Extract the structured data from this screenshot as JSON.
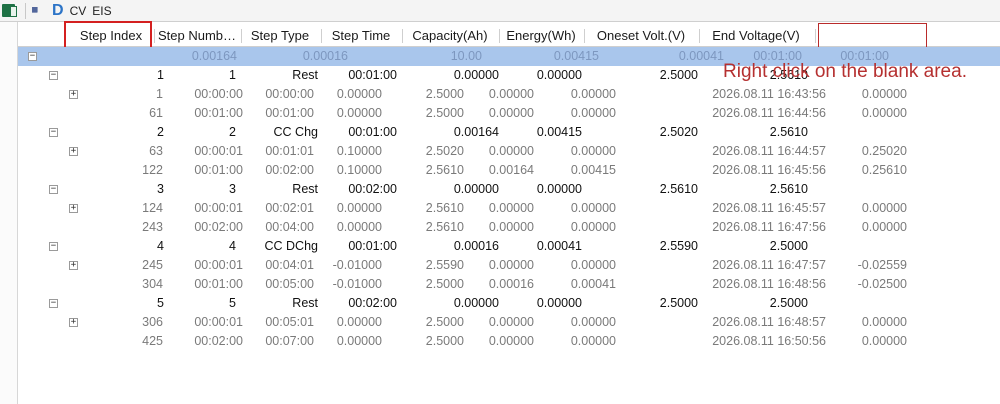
{
  "toolbar": {
    "items": [
      {
        "icon": "excel-icon"
      },
      {
        "icon": "grid-icon"
      },
      {
        "icon": "d-icon",
        "text": "D"
      },
      {
        "label": "CV"
      },
      {
        "label": "EIS"
      }
    ]
  },
  "columns": [
    "Step Index",
    "Step Numb…",
    "Step Type",
    "Step Time",
    "Capacity(Ah)",
    "Energy(Wh)",
    "Oneset Volt.(V)",
    "End Voltage(V)"
  ],
  "selected_row": {
    "cells": [
      "0.00164",
      "0.00016",
      "10.00",
      "0.00415",
      "0.00041",
      "00:01:00",
      "00:01:00"
    ]
  },
  "groups": [
    {
      "step": [
        "1",
        "1",
        "Rest",
        "00:01:00",
        "0.00000",
        "0.00000",
        "2.5000",
        "2.5610"
      ],
      "records": [
        [
          "1",
          "00:00:00",
          "00:00:00",
          "0.00000",
          "2.5000",
          "0.00000",
          "0.00000",
          "2026.08.11 16:43:56",
          "0.00000"
        ],
        [
          "61",
          "00:01:00",
          "00:01:00",
          "0.00000",
          "2.5000",
          "0.00000",
          "0.00000",
          "2026.08.11 16:44:56",
          "0.00000"
        ]
      ]
    },
    {
      "step": [
        "2",
        "2",
        "CC Chg",
        "00:01:00",
        "0.00164",
        "0.00415",
        "2.5020",
        "2.5610"
      ],
      "records": [
        [
          "63",
          "00:00:01",
          "00:01:01",
          "0.10000",
          "2.5020",
          "0.00000",
          "0.00000",
          "2026.08.11 16:44:57",
          "0.25020"
        ],
        [
          "122",
          "00:01:00",
          "00:02:00",
          "0.10000",
          "2.5610",
          "0.00164",
          "0.00415",
          "2026.08.11 16:45:56",
          "0.25610"
        ]
      ]
    },
    {
      "step": [
        "3",
        "3",
        "Rest",
        "00:02:00",
        "0.00000",
        "0.00000",
        "2.5610",
        "2.5610"
      ],
      "records": [
        [
          "124",
          "00:00:01",
          "00:02:01",
          "0.00000",
          "2.5610",
          "0.00000",
          "0.00000",
          "2026.08.11 16:45:57",
          "0.00000"
        ],
        [
          "243",
          "00:02:00",
          "00:04:00",
          "0.00000",
          "2.5610",
          "0.00000",
          "0.00000",
          "2026.08.11 16:47:56",
          "0.00000"
        ]
      ]
    },
    {
      "step": [
        "4",
        "4",
        "CC DChg",
        "00:01:00",
        "0.00016",
        "0.00041",
        "2.5590",
        "2.5000"
      ],
      "records": [
        [
          "245",
          "00:00:01",
          "00:04:01",
          "-0.01000",
          "2.5590",
          "0.00000",
          "0.00000",
          "2026.08.11 16:47:57",
          "-0.02559"
        ],
        [
          "304",
          "00:01:00",
          "00:05:00",
          "-0.01000",
          "2.5000",
          "0.00016",
          "0.00041",
          "2026.08.11 16:48:56",
          "-0.02500"
        ]
      ]
    },
    {
      "step": [
        "5",
        "5",
        "Rest",
        "00:02:00",
        "0.00000",
        "0.00000",
        "2.5000",
        "2.5000"
      ],
      "records": [
        [
          "306",
          "00:00:01",
          "00:05:01",
          "0.00000",
          "2.5000",
          "0.00000",
          "0.00000",
          "2026.08.11 16:48:57",
          "0.00000"
        ],
        [
          "425",
          "00:02:00",
          "00:07:00",
          "0.00000",
          "2.5000",
          "0.00000",
          "0.00000",
          "2026.08.11 16:50:56",
          "0.00000"
        ]
      ]
    }
  ],
  "expander_symbols": {
    "collapse": "−",
    "expand": "+"
  },
  "annotation": "Right click on the blank area.",
  "colors": {
    "highlight_box": "#d42020",
    "annotation_text": "#b53030",
    "selected_row_bg": "#a9c6ec"
  }
}
